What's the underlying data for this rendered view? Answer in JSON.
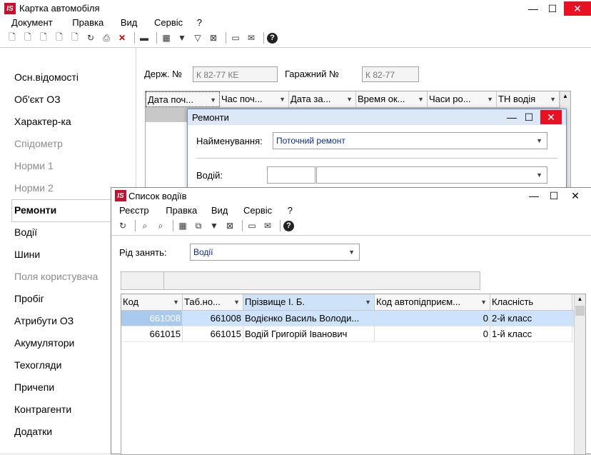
{
  "main": {
    "title": "Картка автомобіля",
    "menu": [
      "Документ",
      "Правка",
      "Вид",
      "Сервіс",
      "?"
    ],
    "derzh_label": "Держ. №",
    "derzh_value": "К 82-77 КЕ",
    "garage_label": "Гаражний №",
    "garage_value": "К 82-77",
    "sidebar": [
      "Осн.відомості",
      "Об'єкт ОЗ",
      "Характер-ка",
      "Спідометр",
      "Норми 1",
      "Норми 2",
      "Ремонти",
      "Водії",
      "Шини",
      "Поля користувача",
      "Пробіг",
      "Атрибути ОЗ",
      "Акумулятори",
      "Техогляди",
      "Причепи",
      "Контрагенти",
      "Додатки"
    ],
    "columns": [
      "Дата поч...",
      "Час поч...",
      "Дата за...",
      "Время ок...",
      "Часи ро...",
      "ТН водія"
    ]
  },
  "repairs": {
    "title": "Ремонти",
    "name_label": "Найменування:",
    "name_value": "Поточний ремонт",
    "driver_label": "Водій:"
  },
  "drivers": {
    "title": "Список водіїв",
    "menu": [
      "Реєстр",
      "Правка",
      "Вид",
      "Сервіс",
      "?"
    ],
    "occupation_label": "Рід занять:",
    "occupation_value": "Водії",
    "columns": [
      "Код",
      "Таб.но...",
      "Прізвище І. Б.",
      "Код автопідприєм...",
      "Класність"
    ],
    "rows": [
      [
        "661008",
        "661008",
        "Водієнко Василь Володи...",
        "0",
        "2-й класс"
      ],
      [
        "661015",
        "661015",
        "Водій Григорій Іванович",
        "0",
        "1-й класс"
      ]
    ]
  },
  "window_buttons": {
    "min": "—",
    "max": "☐",
    "close": "✕"
  }
}
